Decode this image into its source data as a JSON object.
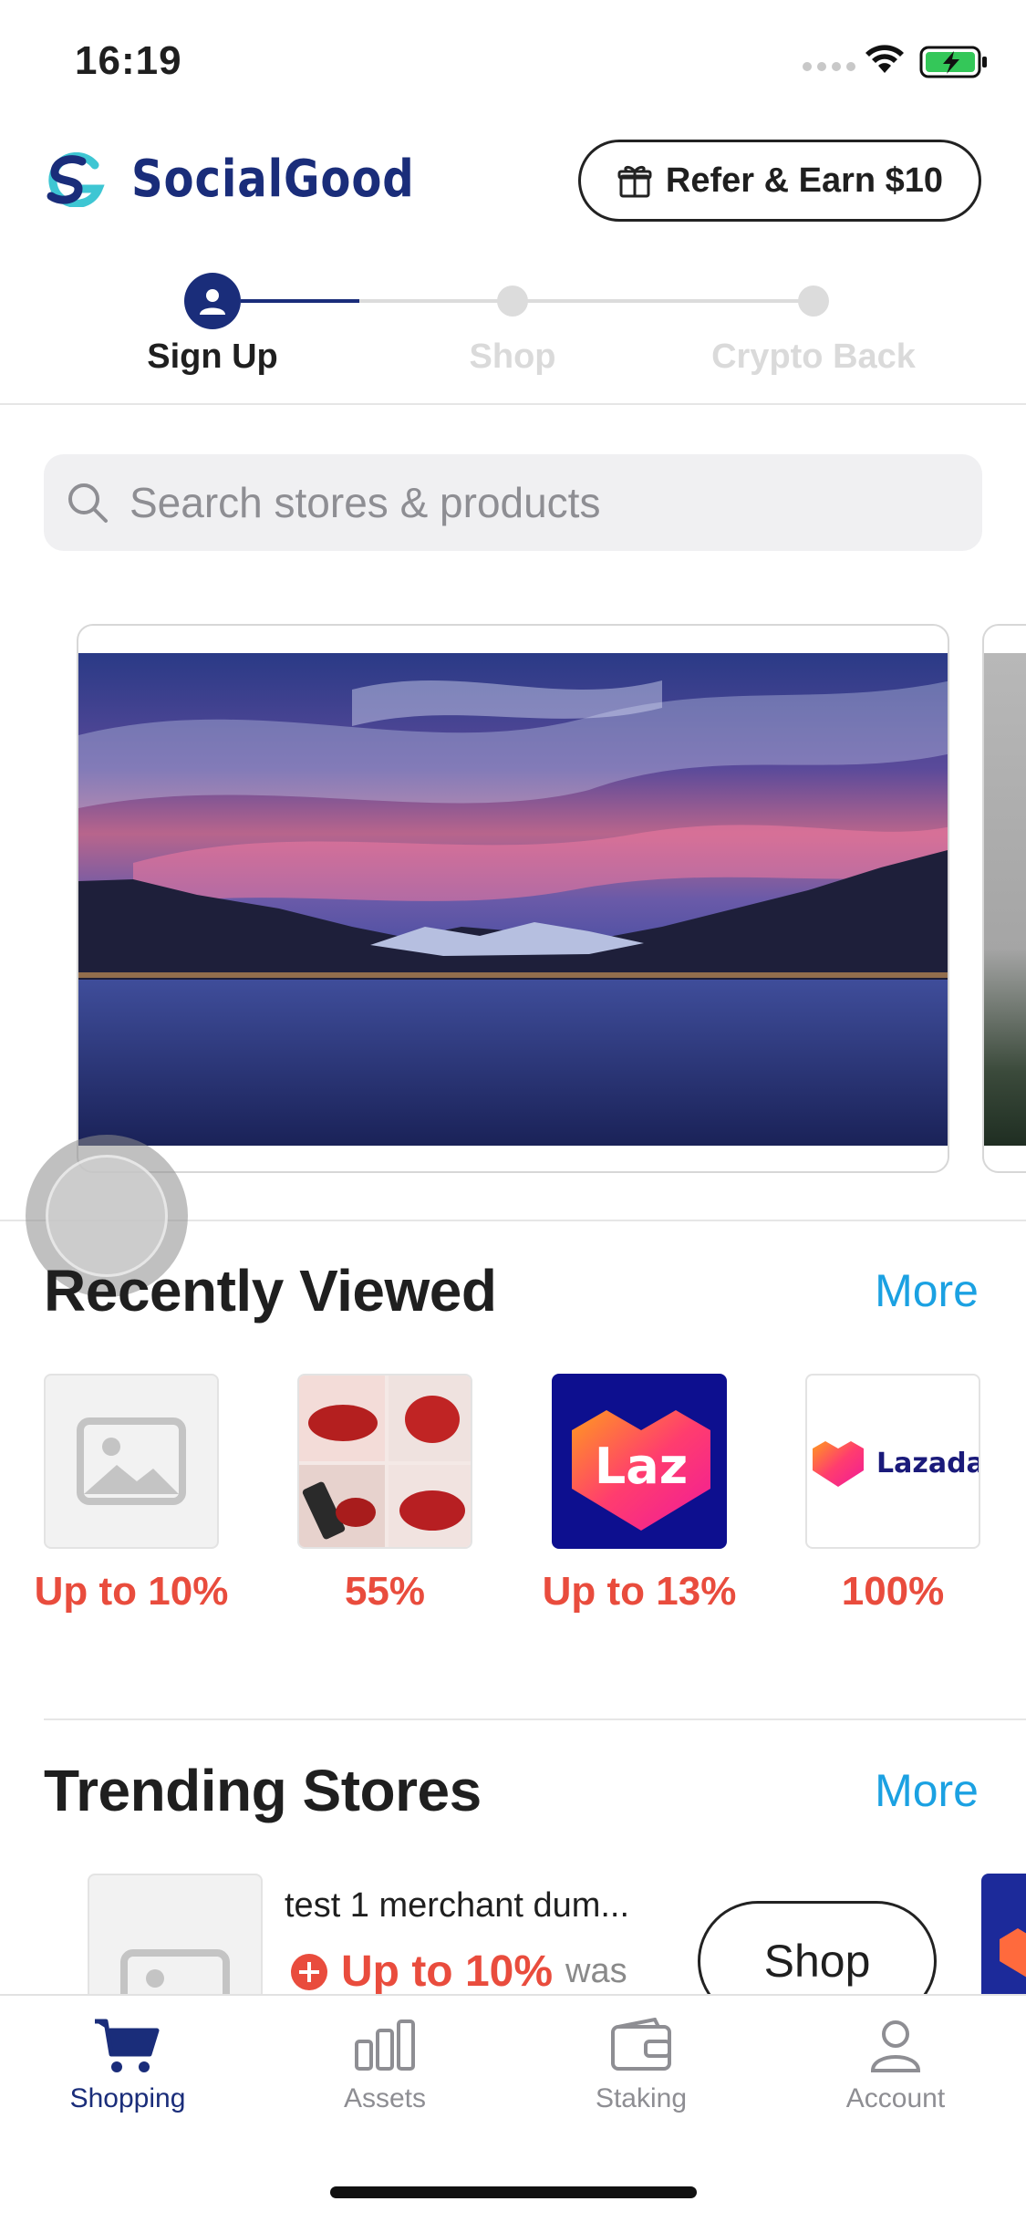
{
  "status_bar": {
    "time": "16:19"
  },
  "header": {
    "brand_name": "SocialGood",
    "refer_label": "Refer & Earn $10"
  },
  "stepper": {
    "steps": [
      {
        "label": "Sign Up"
      },
      {
        "label": "Shop"
      },
      {
        "label": "Crypto Back"
      }
    ]
  },
  "search": {
    "placeholder": "Search stores & products"
  },
  "recently_viewed": {
    "title": "Recently Viewed",
    "more_label": "More",
    "items": [
      {
        "cashback": "Up to 10%",
        "image": "placeholder-image-icon"
      },
      {
        "cashback": "55%",
        "image": "lipstick-photo"
      },
      {
        "cashback": "Up to 13%",
        "image": "laz-logo",
        "logo_text": "Laz"
      },
      {
        "cashback": "100%",
        "image": "lazada-logo",
        "logo_text": "Lazada"
      }
    ]
  },
  "trending_stores": {
    "title": "Trending Stores",
    "more_label": "More",
    "stores": [
      {
        "name": "test 1 merchant dum...",
        "cashback": "Up to 10%",
        "was_label": "was",
        "shop_label": "Shop"
      }
    ]
  },
  "tab_bar": {
    "tabs": [
      {
        "label": "Shopping",
        "icon": "cart-icon",
        "active": true
      },
      {
        "label": "Assets",
        "icon": "bar-chart-icon",
        "active": false
      },
      {
        "label": "Staking",
        "icon": "wallet-icon",
        "active": false
      },
      {
        "label": "Account",
        "icon": "person-icon",
        "active": false
      }
    ]
  },
  "colors": {
    "brand_navy": "#1a2d7a",
    "cashback_red": "#e94c3d",
    "link_blue": "#1ba1e2",
    "brand_teal": "#3ec6d3"
  }
}
